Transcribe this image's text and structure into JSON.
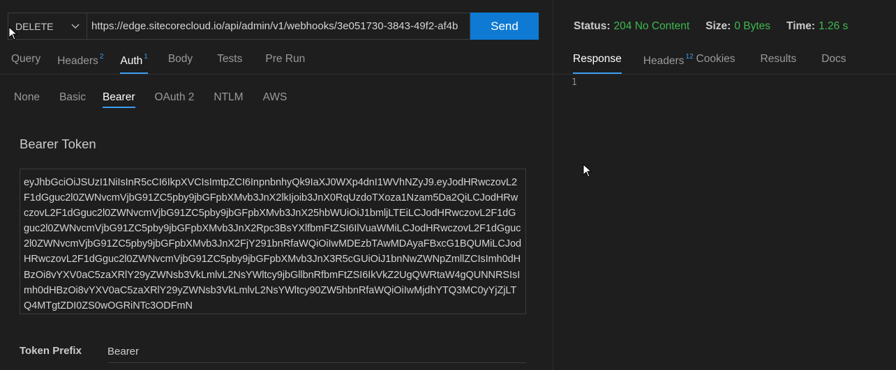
{
  "request": {
    "method": "DELETE",
    "url": "https://edge.sitecorecloud.io/api/admin/v1/webhooks/3e051730-3843-49f2-af4b",
    "send_label": "Send"
  },
  "request_tabs": [
    {
      "label": "Query",
      "badge": ""
    },
    {
      "label": "Headers",
      "badge": "2"
    },
    {
      "label": "Auth",
      "badge": "1"
    },
    {
      "label": "Body",
      "badge": ""
    },
    {
      "label": "Tests",
      "badge": ""
    },
    {
      "label": "Pre Run",
      "badge": ""
    }
  ],
  "auth_tabs": [
    "None",
    "Basic",
    "Bearer",
    "OAuth 2",
    "NTLM",
    "AWS"
  ],
  "bearer": {
    "title": "Bearer Token",
    "token": "eyJhbGciOiJSUzI1NiIsInR5cCI6IkpXVCIsImtpZCI6InpnbnhyQk9IaXJ0WXp4dnI1WVhNZyJ9.eyJodHRwczovL2F1dGguc2l0ZWNvcmVjbG91ZC5pby9jbGFpbXMvb3JnX2lkIjoib3JnX0RqUzdoTXoza1Nzam5Da2QiLCJodHRwczovL2F1dGguc2l0ZWNvcmVjbG91ZC5pby9jbGFpbXMvb3JnX25hbWUiOiJ1bmljLTEiLCJodHRwczovL2F1dGguc2l0ZWNvcmVjbG91ZC5pby9jbGFpbXMvb3JnX2Rpc3BsYXlfbmFtZSI6IlVuaWMiLCJodHRwczovL2F1dGguc2l0ZWNvcmVjbG91ZC5pby9jbGFpbXMvb3JnX2FjY291bnRfaWQiOiIwMDEzbTAwMDAyaFBxcG1BQUMiLCJodHRwczovL2F1dGguc2l0ZWNvcmVjbG91ZC5pby9jbGFpbXMvb3JnX3R5cGUiOiJ1bnNwZWNpZmllZCIsImh0dHBzOi8vYXV0aC5zaXRlY29yZWNsb3VkLmlvL2NsYWltcy9jbGllbnRfbmFtZSI6IkVkZ2UgQWRtaW4gQUNNRSIsImh0dHBzOi8vYXV0aC5zaXRlY29yZWNsb3VkLmlvL2NsYWltcy90ZW5hbnRfaWQiOiIwMjdhYTQ3MC0yYjZjLTQ4MTgtZDI0ZS0wOGRiNTc3ODFmN",
    "prefix_label": "Token Prefix",
    "prefix_value": "Bearer"
  },
  "response": {
    "status_label": "Status:",
    "status_value": "204 No Content",
    "size_label": "Size:",
    "size_value": "0 Bytes",
    "time_label": "Time:",
    "time_value": "1.26 s",
    "tabs": [
      {
        "label": "Response",
        "badge": ""
      },
      {
        "label": "Headers",
        "badge": "12"
      },
      {
        "label": "Cookies",
        "badge": ""
      },
      {
        "label": "Results",
        "badge": ""
      },
      {
        "label": "Docs",
        "badge": ""
      }
    ],
    "line_number": "1"
  },
  "colors": {
    "accent": "#3c9df1",
    "send_button": "#0e7ad3",
    "status_ok": "#3fb950",
    "background": "#1e1e1e"
  },
  "icons": [
    "chevron-down-icon",
    "mouse-pointer-icon"
  ]
}
